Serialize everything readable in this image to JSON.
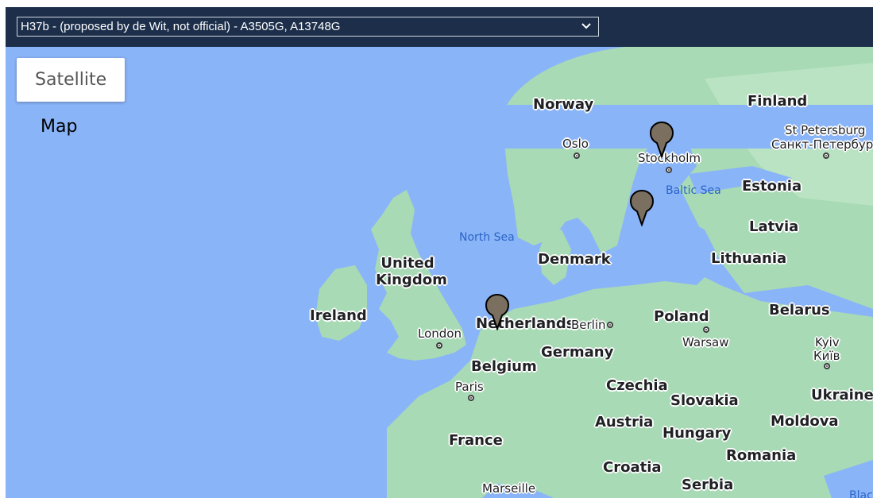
{
  "header": {
    "haplogroup_select": "H37b - (proposed by de Wit, not official) - A3505G, A13748G",
    "chevron_icon": "chevron-down-icon"
  },
  "map_type": {
    "map_label": "Map",
    "satellite_label": "Satellite"
  },
  "countries": {
    "norway": "Norway",
    "finland": "Finland",
    "estonia": "Estonia",
    "latvia": "Latvia",
    "lithuania": "Lithuania",
    "denmark": "Denmark",
    "uk_line1": "United",
    "uk_line2": "Kingdom",
    "ireland": "Ireland",
    "netherlands": "Netherlands",
    "belarus": "Belarus",
    "poland": "Poland",
    "germany": "Germany",
    "belgium": "Belgium",
    "czechia": "Czechia",
    "slovakia": "Slovakia",
    "ukraine": "Ukraine",
    "austria": "Austria",
    "hungary": "Hungary",
    "moldova": "Moldova",
    "france": "France",
    "romania": "Romania",
    "croatia": "Croatia",
    "serbia": "Serbia"
  },
  "cities": {
    "oslo": "Oslo",
    "stockholm": "Stockholm",
    "st_petersburg_1": "St Petersburg",
    "st_petersburg_2": "Санкт-Петербург",
    "london": "London",
    "berlin": "Berlin",
    "warsaw": "Warsaw",
    "kyiv_1": "Kyiv",
    "kyiv_2": "Київ",
    "paris": "Paris",
    "marseille": "Marseille"
  },
  "seas": {
    "north_sea": "North Sea",
    "baltic_sea": "Baltic Sea",
    "black_sea": "Blac"
  },
  "markers": [
    {
      "name": "marker-stockholm",
      "icon": "map-pin-icon"
    },
    {
      "name": "marker-south-sweden",
      "icon": "map-pin-icon"
    },
    {
      "name": "marker-netherlands",
      "icon": "map-pin-icon"
    }
  ],
  "colors": {
    "water": "#8ab4f8",
    "land": "#a8dab5",
    "header": "#1c2e4a",
    "marker": "#7b6f5f"
  }
}
